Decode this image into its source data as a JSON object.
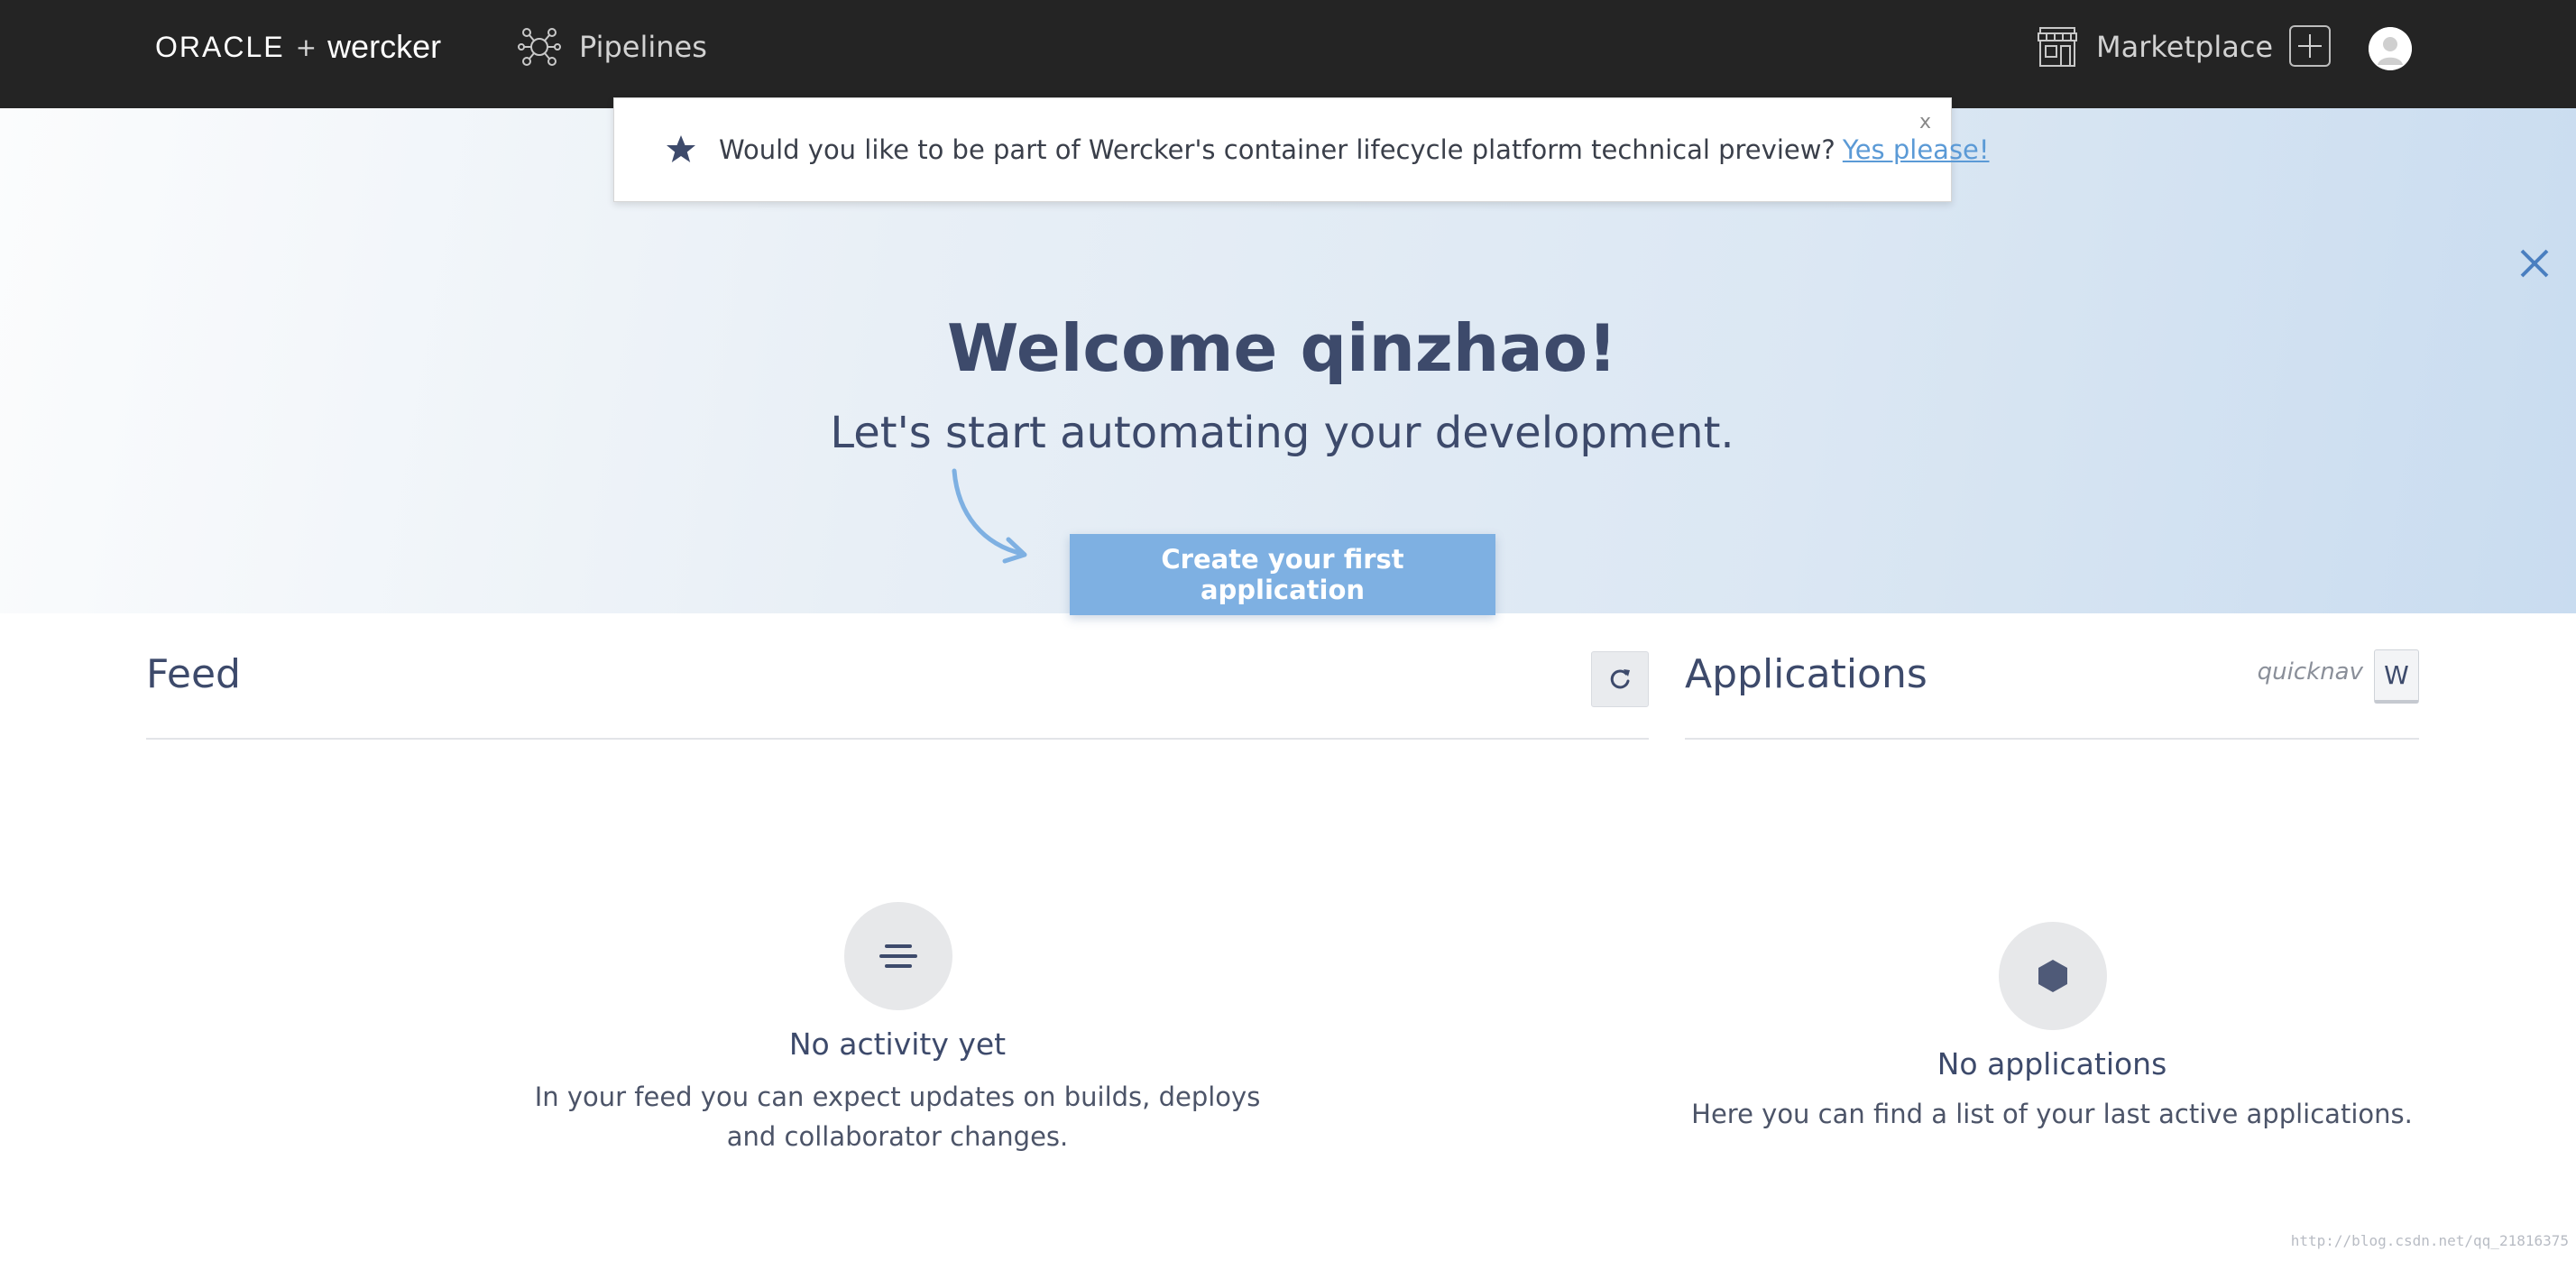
{
  "nav": {
    "brand_oracle": "ORACLE",
    "brand_plus": "+",
    "brand_wercker": "wercker",
    "pipelines_label": "Pipelines",
    "marketplace_label": "Marketplace",
    "add_icon": "plus-icon",
    "avatar_icon": "user-avatar-icon",
    "background_color": "#242424"
  },
  "notice": {
    "icon": "star-icon",
    "text": "Would you like to be part of Wercker's container lifecycle platform technical preview?",
    "link_label": "Yes please!",
    "close_label": "x",
    "link_color": "#5b9ad6"
  },
  "hero": {
    "title": "Welcome qinzhao!",
    "subtitle": "Let's start automating your development.",
    "cta_label": "Create your first application",
    "cta_color": "#7eb0e2",
    "close_icon": "close-icon"
  },
  "feed": {
    "title": "Feed",
    "refresh_icon": "refresh-icon",
    "empty_icon": "feed-lines-icon",
    "empty_title": "No activity yet",
    "empty_description": "In your feed you can expect updates on builds, deploys and collaborator changes."
  },
  "applications": {
    "title": "Applications",
    "quicknav_label": "quicknav",
    "quicknav_key": "W",
    "empty_icon": "hexagon-icon",
    "empty_title": "No applications",
    "empty_description": "Here you can find a list of your last active applications."
  },
  "watermark": "http://blog.csdn.net/qq_21816375",
  "colors": {
    "text_primary": "#3d4a6b",
    "accent": "#7eb0e2"
  }
}
